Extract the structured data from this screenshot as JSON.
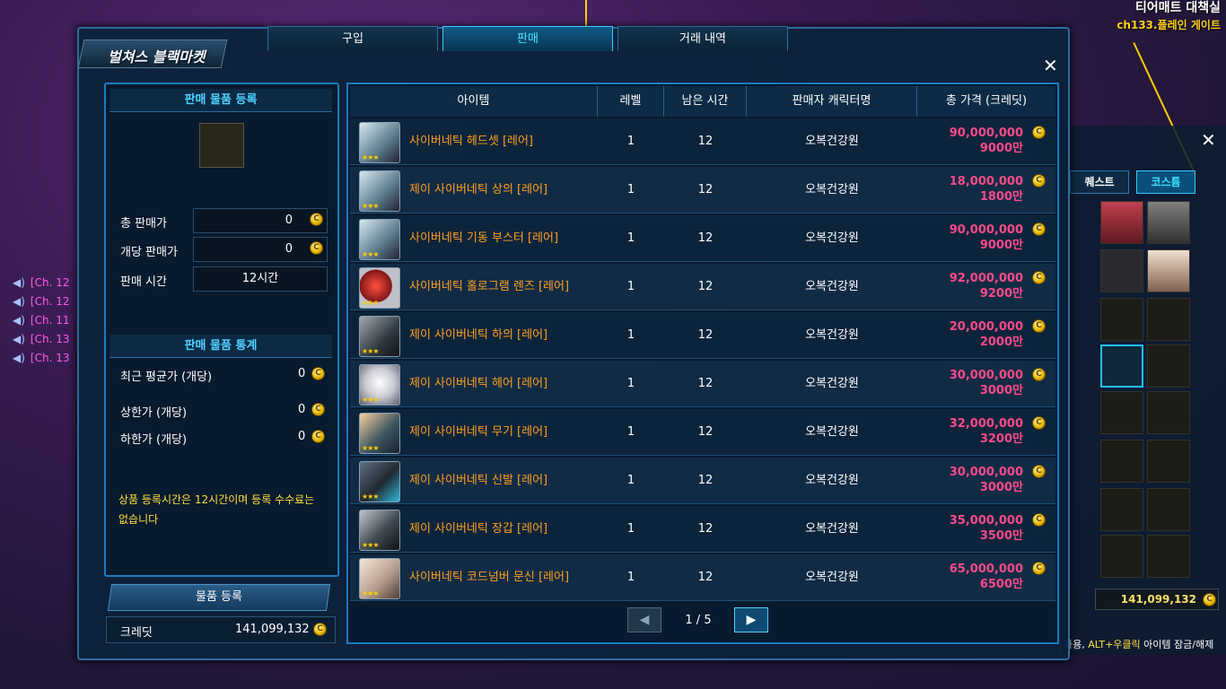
{
  "location": {
    "name": "티어매트 대책실",
    "channel": "ch133.플레인 게이트"
  },
  "chat": [
    "[Ch. 12",
    "[Ch. 12",
    "[Ch. 11",
    "[Ch. 13",
    "[Ch. 13"
  ],
  "inventory": {
    "tabs": [
      "퀘스트",
      "코스튬"
    ],
    "money": "141,099,132",
    "hint_key": "ALT+우클릭",
    "hint_pre": "사용, ",
    "hint_post": " 아이템 잠금/해제"
  },
  "window": {
    "title": "벌쳐스 블랙마켓",
    "tabs": [
      "구입",
      "판매",
      "거래 내역"
    ],
    "active_tab": "판매"
  },
  "left_panel": {
    "register_header": "판매 물품 등록",
    "total_price_label": "총 판매가",
    "total_price_value": "0",
    "unit_price_label": "개당 판매가",
    "unit_price_value": "0",
    "sale_time_label": "판매 시간",
    "sale_time_value": "12시간",
    "stats_header": "판매 물품 통계",
    "stats": [
      {
        "label": "최근 평균가 (개당)",
        "value": "0"
      },
      {
        "label": "상한가 (개당)",
        "value": "0"
      },
      {
        "label": "하한가 (개당)",
        "value": "0"
      }
    ],
    "note": "상품 등록시간은 12시간이며 등록 수수료는 없습니다",
    "register_button": "물품 등록",
    "credit_label": "크레딧",
    "credit_value": "141,099,132"
  },
  "table": {
    "headers": [
      "아이템",
      "레벨",
      "남은 시간",
      "판매자 캐릭터명",
      "총 가격 (크레딧)"
    ],
    "rows": [
      {
        "name": "사이버네틱 헤드셋 [레어]",
        "level": "1",
        "time": "12",
        "seller": "오복건강원",
        "price": "90,000,000",
        "price_short": "9000만"
      },
      {
        "name": "제이 사이버네틱 상의 [레어]",
        "level": "1",
        "time": "12",
        "seller": "오복건강원",
        "price": "18,000,000",
        "price_short": "1800만"
      },
      {
        "name": "사이버네틱 기동 부스터 [레어]",
        "level": "1",
        "time": "12",
        "seller": "오복건강원",
        "price": "90,000,000",
        "price_short": "9000만"
      },
      {
        "name": "사이버네틱 홀로그램 렌즈 [레어]",
        "level": "1",
        "time": "12",
        "seller": "오복건강원",
        "price": "92,000,000",
        "price_short": "9200만"
      },
      {
        "name": "제이 사이버네틱 하의 [레어]",
        "level": "1",
        "time": "12",
        "seller": "오복건강원",
        "price": "20,000,000",
        "price_short": "2000만"
      },
      {
        "name": "제이 사이버네틱 헤어 [레어]",
        "level": "1",
        "time": "12",
        "seller": "오복건강원",
        "price": "30,000,000",
        "price_short": "3000만"
      },
      {
        "name": "제이 사이버네틱 무기 [레어]",
        "level": "1",
        "time": "12",
        "seller": "오복건강원",
        "price": "32,000,000",
        "price_short": "3200만"
      },
      {
        "name": "제이 사이버네틱 신발 [레어]",
        "level": "1",
        "time": "12",
        "seller": "오복건강원",
        "price": "30,000,000",
        "price_short": "3000만"
      },
      {
        "name": "제이 사이버네틱 장갑 [레어]",
        "level": "1",
        "time": "12",
        "seller": "오복건강원",
        "price": "35,000,000",
        "price_short": "3500만"
      },
      {
        "name": "사이버네틱 코드넘버 문신 [레어]",
        "level": "1",
        "time": "12",
        "seller": "오복건강원",
        "price": "65,000,000",
        "price_short": "6500만"
      }
    ],
    "page": "1 / 5"
  }
}
